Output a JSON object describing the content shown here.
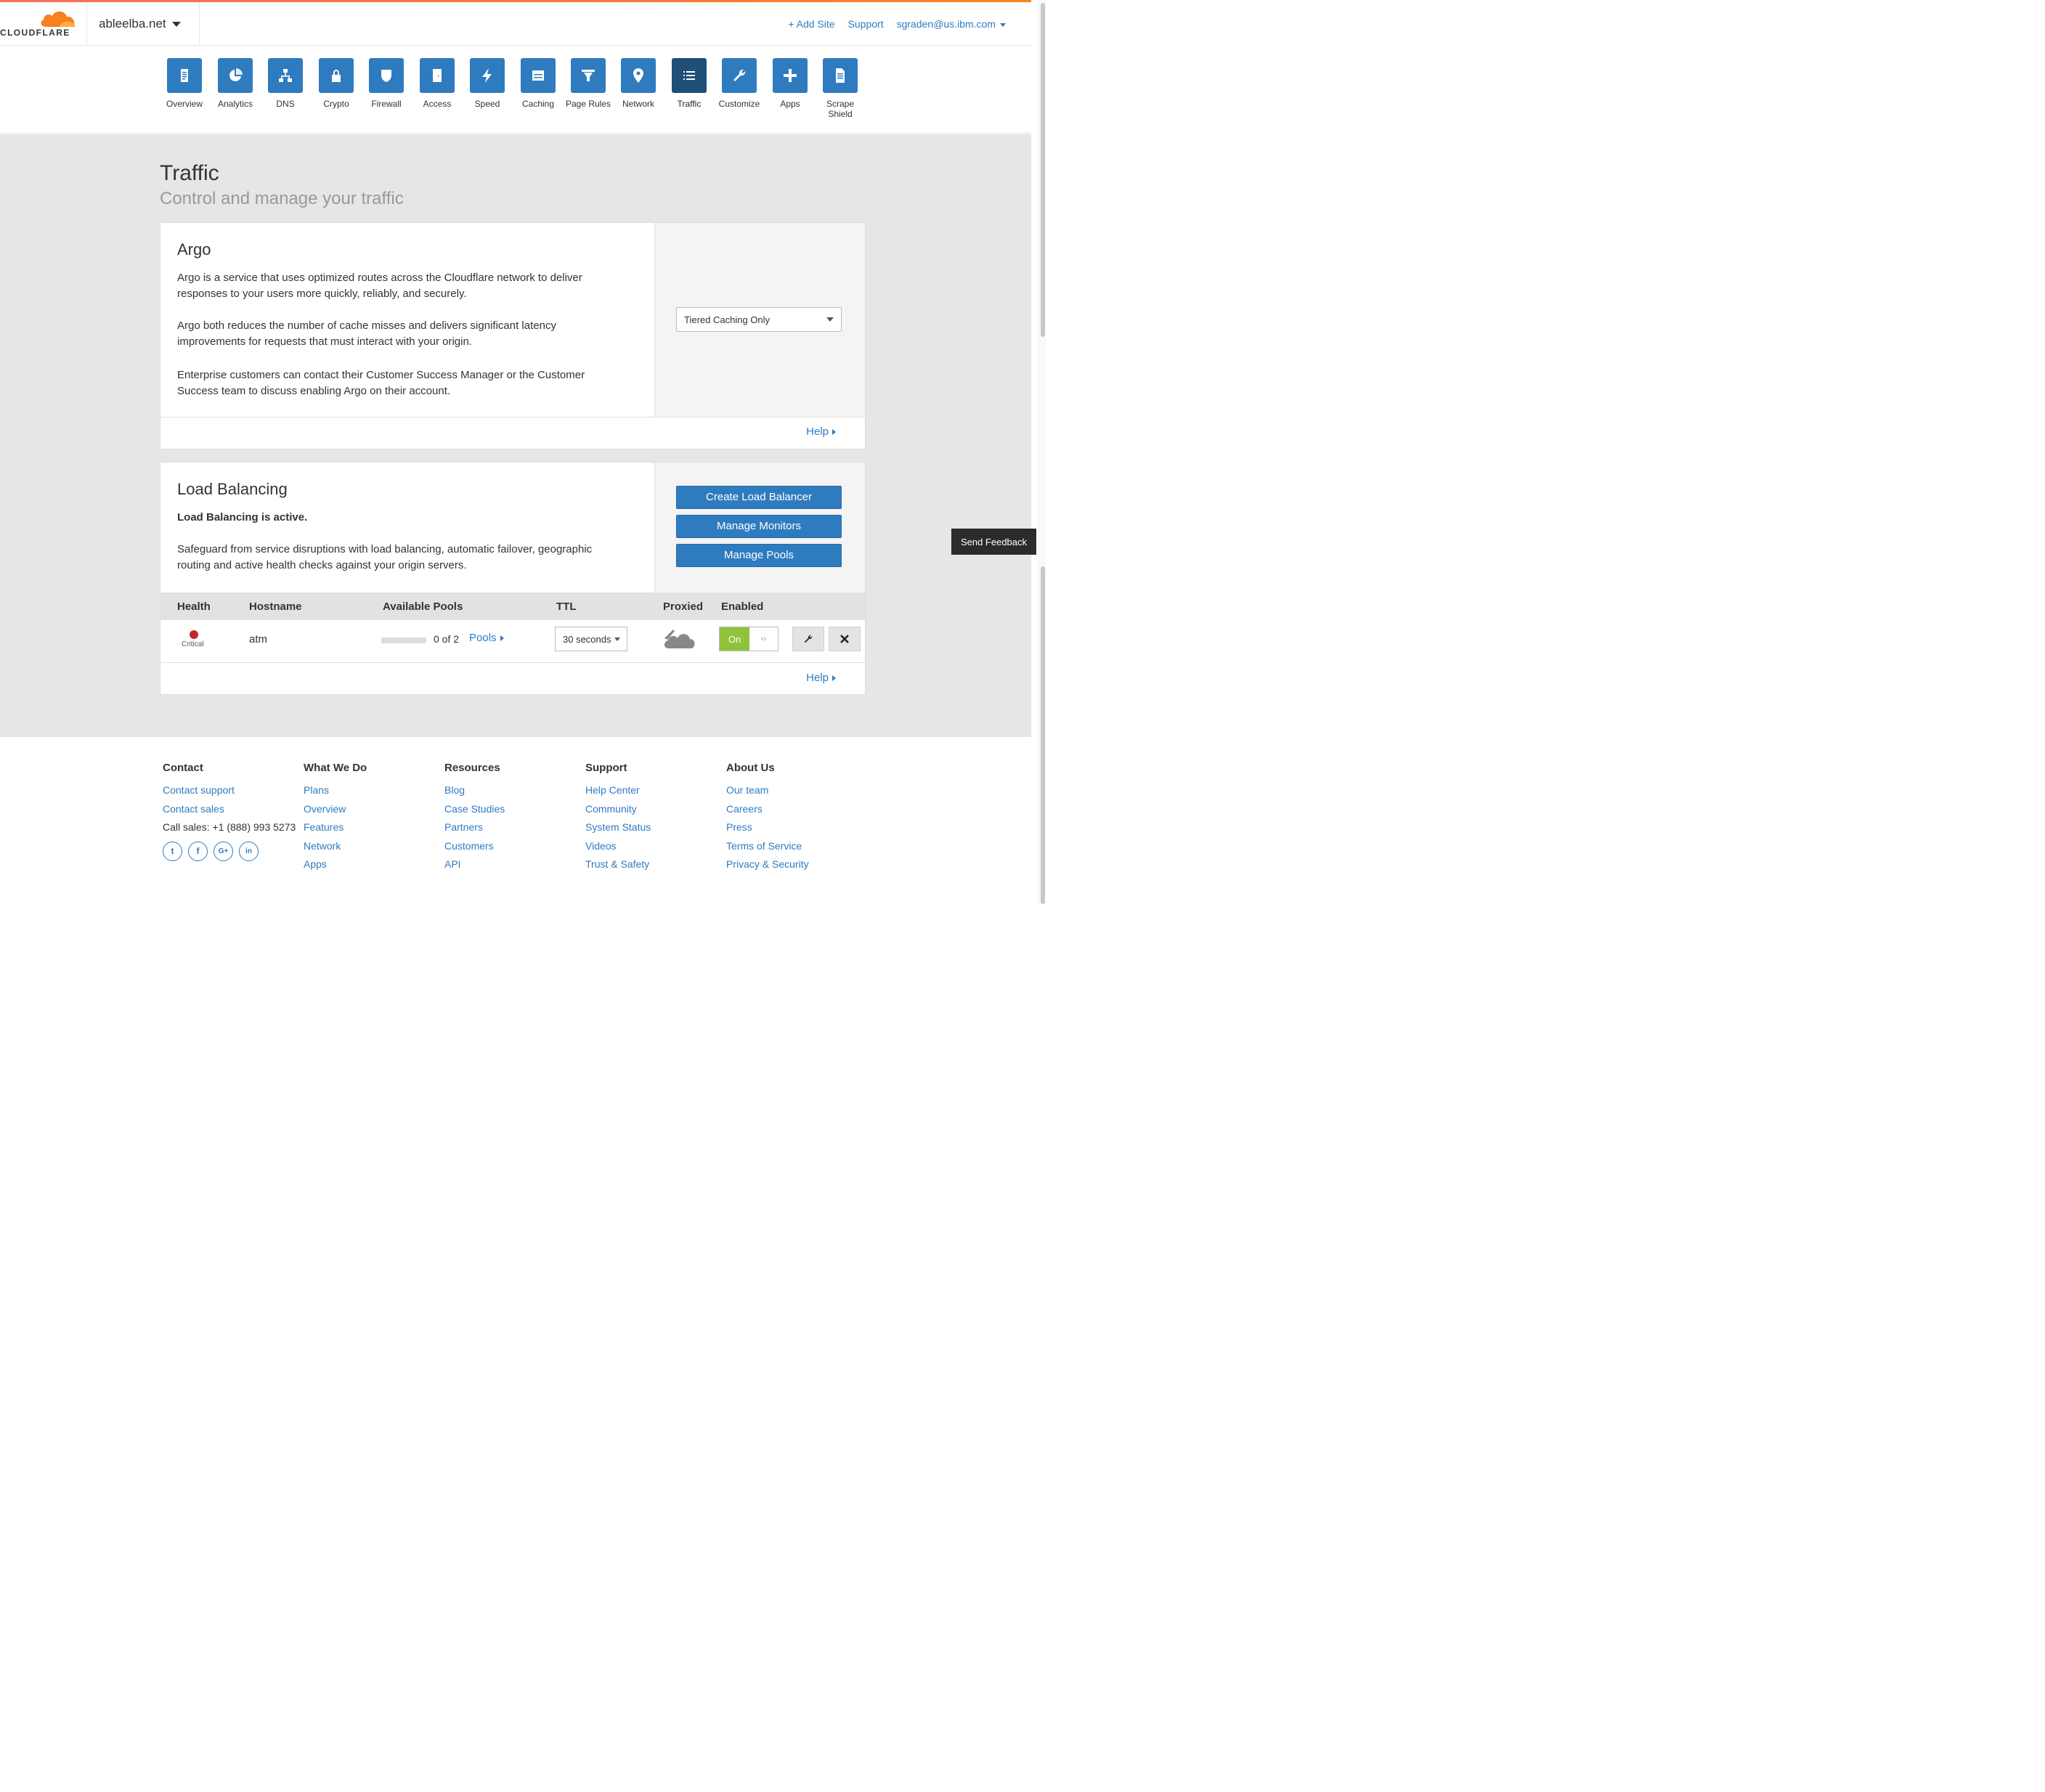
{
  "header": {
    "logo_text": "CLOUDFLARE",
    "domain": "ableelba.net",
    "add_site": "+ Add Site",
    "support": "Support",
    "account": "sgraden@us.ibm.com"
  },
  "nav": {
    "items": [
      {
        "label": "Overview",
        "icon": "clipboard-icon"
      },
      {
        "label": "Analytics",
        "icon": "pie-chart-icon"
      },
      {
        "label": "DNS",
        "icon": "network-tree-icon"
      },
      {
        "label": "Crypto",
        "icon": "lock-icon"
      },
      {
        "label": "Firewall",
        "icon": "shield-icon"
      },
      {
        "label": "Access",
        "icon": "door-icon"
      },
      {
        "label": "Speed",
        "icon": "lightning-icon"
      },
      {
        "label": "Caching",
        "icon": "server-icon"
      },
      {
        "label": "Page Rules",
        "icon": "filter-icon"
      },
      {
        "label": "Network",
        "icon": "location-pin-icon"
      },
      {
        "label": "Traffic",
        "icon": "list-icon",
        "active": true
      },
      {
        "label": "Customize",
        "icon": "wrench-icon"
      },
      {
        "label": "Apps",
        "icon": "plus-icon"
      },
      {
        "label": "Scrape Shield",
        "icon": "document-icon"
      }
    ]
  },
  "page": {
    "title": "Traffic",
    "subtitle": "Control and manage your traffic"
  },
  "argo": {
    "title": "Argo",
    "p1": "Argo is a service that uses optimized routes across the Cloudflare network to deliver responses to your users more quickly, reliably, and securely.",
    "p2": "Argo both reduces the number of cache misses and delivers significant latency improvements for requests that must interact with your origin.",
    "p3": "Enterprise customers can contact their Customer Success Manager or the Customer Success team to discuss enabling Argo on their account.",
    "select_value": "Tiered Caching Only",
    "help": "Help"
  },
  "lb": {
    "title": "Load Balancing",
    "status": "Load Balancing is active.",
    "description": "Safeguard from service disruptions with load balancing, automatic failover, geographic routing and active health checks against your origin servers.",
    "create_button": "Create Load Balancer",
    "monitors_button": "Manage Monitors",
    "pools_button": "Manage Pools",
    "columns": [
      "Health",
      "Hostname",
      "Available Pools",
      "TTL",
      "Proxied",
      "Enabled"
    ],
    "row": {
      "health": "Critical",
      "health_color": "#c0282d",
      "hostname": "atm",
      "pools_available": 0,
      "pools_count_text": "0 of 2",
      "pools_link": "Pools",
      "ttl": "30 seconds",
      "enabled_on": "On",
      "enabled_off": "‹›"
    },
    "help": "Help"
  },
  "feedback": "Send Feedback",
  "footer": {
    "contact": {
      "title": "Contact",
      "links": [
        "Contact support",
        "Contact sales"
      ],
      "call": "Call sales: +1 (888) 993 5273",
      "social": [
        "twitter-icon",
        "facebook-icon",
        "google-plus-icon",
        "linkedin-icon"
      ]
    },
    "what_we_do": {
      "title": "What We Do",
      "links": [
        "Plans",
        "Overview",
        "Features",
        "Network",
        "Apps"
      ]
    },
    "resources": {
      "title": "Resources",
      "links": [
        "Blog",
        "Case Studies",
        "Partners",
        "Customers",
        "API"
      ]
    },
    "support": {
      "title": "Support",
      "links": [
        "Help Center",
        "Community",
        "System Status",
        "Videos",
        "Trust & Safety"
      ]
    },
    "about": {
      "title": "About Us",
      "links": [
        "Our team",
        "Careers",
        "Press",
        "Terms of Service",
        "Privacy & Security"
      ]
    }
  },
  "colors": {
    "accent": "#2f7bbf",
    "brand_orange": "#f6821f",
    "active_nav": "#1f4e79",
    "toggle_on": "#8fc33a"
  }
}
